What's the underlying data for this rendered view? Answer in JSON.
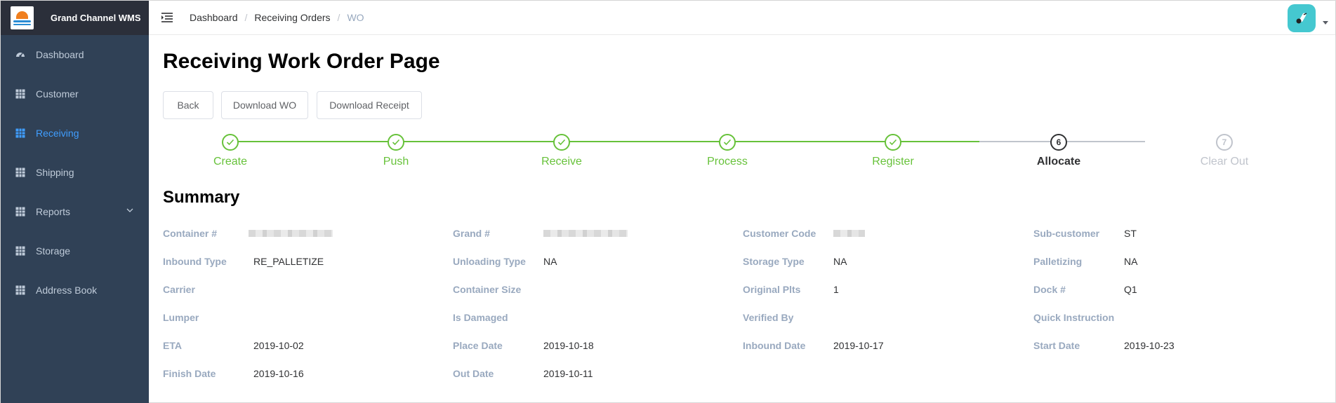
{
  "app": {
    "name": "Grand Channel WMS"
  },
  "sidebar": {
    "items": [
      {
        "label": "Dashboard",
        "icon": "dashboard-icon",
        "active": false
      },
      {
        "label": "Customer",
        "icon": "table-icon",
        "active": false
      },
      {
        "label": "Receiving",
        "icon": "table-icon",
        "active": true
      },
      {
        "label": "Shipping",
        "icon": "table-icon",
        "active": false
      },
      {
        "label": "Reports",
        "icon": "table-icon",
        "active": false,
        "expandable": true
      },
      {
        "label": "Storage",
        "icon": "table-icon",
        "active": false
      },
      {
        "label": "Address Book",
        "icon": "table-icon",
        "active": false
      }
    ]
  },
  "breadcrumb": {
    "items": [
      "Dashboard",
      "Receiving Orders",
      "WO"
    ]
  },
  "page": {
    "title": "Receiving Work Order Page"
  },
  "buttons": {
    "back": "Back",
    "download_wo": "Download WO",
    "download_receipt": "Download Receipt"
  },
  "steps": {
    "active_index": 5,
    "items": [
      {
        "label": "Create",
        "status": "finish"
      },
      {
        "label": "Push",
        "status": "finish"
      },
      {
        "label": "Receive",
        "status": "finish"
      },
      {
        "label": "Process",
        "status": "finish"
      },
      {
        "label": "Register",
        "status": "finish"
      },
      {
        "label": "Allocate",
        "status": "process",
        "number": "6"
      },
      {
        "label": "Clear Out",
        "status": "wait",
        "number": "7"
      }
    ]
  },
  "summary": {
    "title": "Summary",
    "fields": {
      "container_no": {
        "label": "Container #",
        "value": ""
      },
      "grand_no": {
        "label": "Grand #",
        "value": ""
      },
      "customer_code": {
        "label": "Customer Code",
        "value": ""
      },
      "sub_customer": {
        "label": "Sub-customer",
        "value": "ST"
      },
      "inbound_type": {
        "label": "Inbound Type",
        "value": "RE_PALLETIZE"
      },
      "unloading_type": {
        "label": "Unloading Type",
        "value": "NA"
      },
      "storage_type": {
        "label": "Storage Type",
        "value": "NA"
      },
      "palletizing": {
        "label": "Palletizing",
        "value": "NA"
      },
      "carrier": {
        "label": "Carrier",
        "value": ""
      },
      "container_size": {
        "label": "Container Size",
        "value": ""
      },
      "original_plts": {
        "label": "Original Plts",
        "value": "1"
      },
      "dock_no": {
        "label": "Dock #",
        "value": "Q1"
      },
      "lumper": {
        "label": "Lumper",
        "value": ""
      },
      "is_damaged": {
        "label": "Is Damaged",
        "value": ""
      },
      "verified_by": {
        "label": "Verified By",
        "value": ""
      },
      "quick_instruction": {
        "label": "Quick Instruction",
        "value": ""
      },
      "eta": {
        "label": "ETA",
        "value": "2019-10-02"
      },
      "place_date": {
        "label": "Place Date",
        "value": "2019-10-18"
      },
      "inbound_date": {
        "label": "Inbound Date",
        "value": "2019-10-17"
      },
      "start_date": {
        "label": "Start Date",
        "value": "2019-10-23"
      },
      "finish_date": {
        "label": "Finish Date",
        "value": "2019-10-16"
      },
      "out_date": {
        "label": "Out Date",
        "value": "2019-10-11"
      }
    }
  },
  "colors": {
    "sidebar_bg": "#304156",
    "brand_bg": "#2b2f3a",
    "active": "#409eff",
    "success": "#67c23a",
    "wait": "#c0c4cc",
    "label": "#99a9bf"
  }
}
